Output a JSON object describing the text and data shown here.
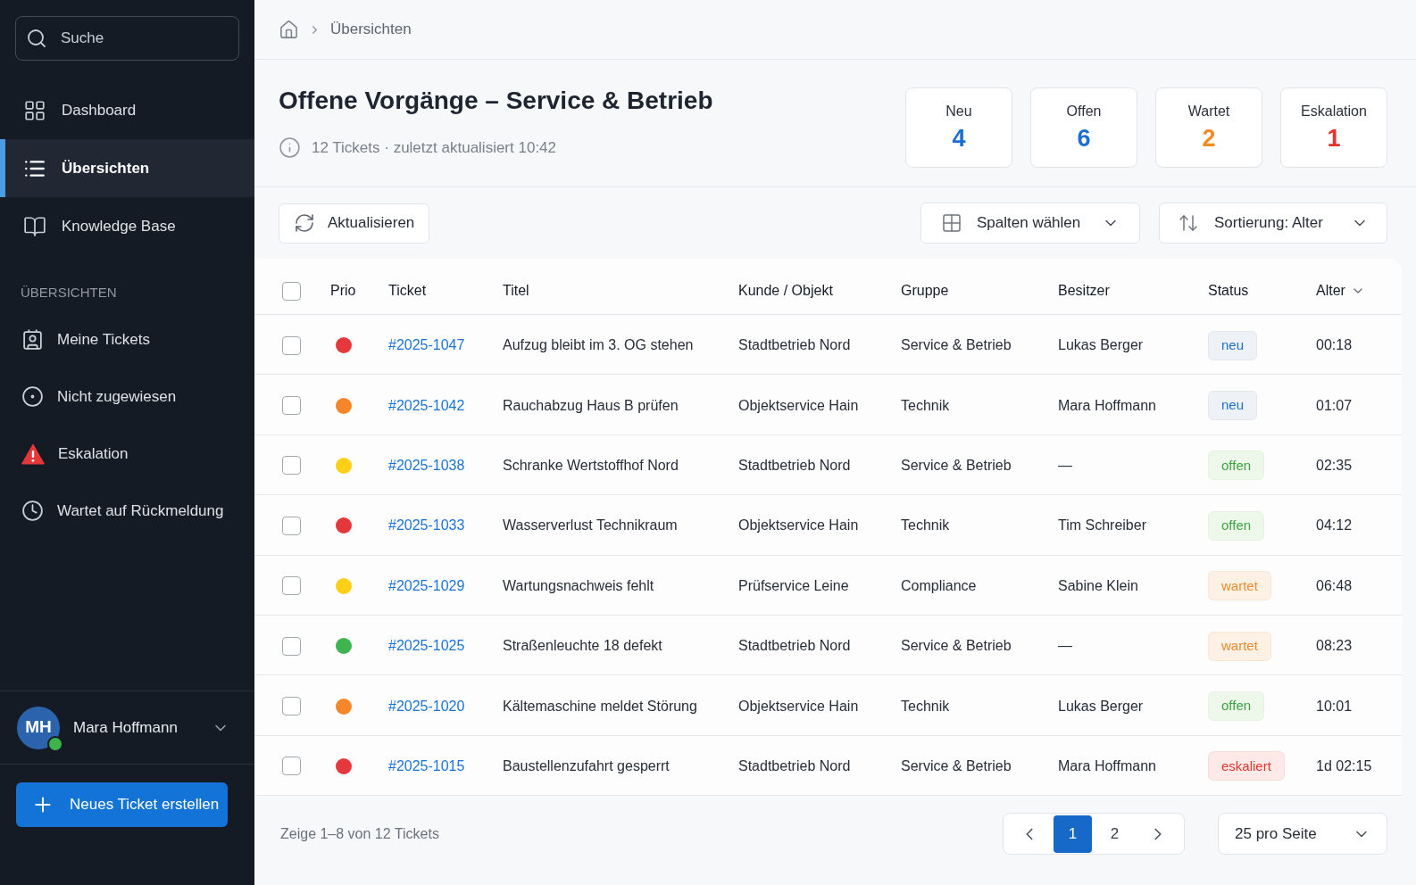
{
  "sidebar": {
    "search": {
      "placeholder": "Suche"
    },
    "nav": [
      {
        "label": "Dashboard",
        "selected": false
      },
      {
        "label": "Übersichten",
        "selected": true
      },
      {
        "label": "Knowledge Base",
        "selected": false
      }
    ],
    "section_heading": "ÜBERSICHTEN",
    "views": [
      {
        "label": "Meine Tickets",
        "selected": false
      },
      {
        "label": "Nicht zugewiesen",
        "selected": false
      },
      {
        "label": "Eskalation",
        "selected": false
      },
      {
        "label": "Wartet auf Rückmeldung",
        "selected": false
      }
    ],
    "user": {
      "initials": "MH",
      "name": "Mara Hoffmann",
      "online": true
    },
    "new_ticket_button": "Neues Ticket erstellen"
  },
  "breadcrumb": [
    "Übersichten"
  ],
  "header": {
    "title": "Offene Vorgänge – Service & Betrieb",
    "subtitle": "12 Tickets · zuletzt aktualisiert 10:42"
  },
  "stats": [
    {
      "label": "Neu",
      "value": "4",
      "color": "#1a6fd0"
    },
    {
      "label": "Offen",
      "value": "6",
      "color": "#1a6fd0"
    },
    {
      "label": "Wartet",
      "value": "2",
      "color": "#f28a26"
    },
    {
      "label": "Eskalation",
      "value": "1",
      "color": "#e0342d"
    }
  ],
  "toolbar": {
    "refresh_button": "Aktualisieren",
    "columns_select": "Spalten wählen",
    "sort_select": "Sortierung: Alter"
  },
  "table": {
    "select_all": {
      "checked": false
    },
    "columns": [
      {
        "label": "Prio",
        "sorted": false
      },
      {
        "label": "Ticket",
        "sorted": false
      },
      {
        "label": "Titel",
        "sorted": false
      },
      {
        "label": "Kunde / Objekt",
        "sorted": false
      },
      {
        "label": "Gruppe",
        "sorted": false
      },
      {
        "label": "Besitzer",
        "sorted": false
      },
      {
        "label": "Status",
        "sorted": false
      },
      {
        "label": "Alter",
        "sorted": true
      }
    ],
    "rows": [
      {
        "checked": false,
        "color": "#e5383b",
        "ticket": "#2025-1047",
        "title": "Aufzug bleibt im 3. OG stehen",
        "customer": "Stadtbetrieb Nord",
        "group": "Service & Betrieb",
        "owner": "Lukas Berger",
        "status": {
          "label": "neu",
          "kind": "new"
        },
        "age": "00:18"
      },
      {
        "checked": false,
        "color": "#f5862a",
        "ticket": "#2025-1042",
        "title": "Rauchabzug Haus B prüfen",
        "customer": "Objektservice Hain",
        "group": "Technik",
        "owner": "Mara Hoffmann",
        "status": {
          "label": "neu",
          "kind": "new"
        },
        "age": "01:07"
      },
      {
        "checked": false,
        "color": "#fdd017",
        "ticket": "#2025-1038",
        "title": "Schranke Wertstoffhof Nord",
        "customer": "Stadtbetrieb Nord",
        "group": "Service & Betrieb",
        "owner": "—",
        "status": {
          "label": "offen",
          "kind": "open"
        },
        "age": "02:35"
      },
      {
        "checked": false,
        "color": "#e5383b",
        "ticket": "#2025-1033",
        "title": "Wasserverlust Technikraum",
        "customer": "Objektservice Hain",
        "group": "Technik",
        "owner": "Tim Schreiber",
        "status": {
          "label": "offen",
          "kind": "open"
        },
        "age": "04:12"
      },
      {
        "checked": false,
        "color": "#fdd017",
        "ticket": "#2025-1029",
        "title": "Wartungsnachweis fehlt",
        "customer": "Prüfservice Leine",
        "group": "Compliance",
        "owner": "Sabine Klein",
        "status": {
          "label": "wartet",
          "kind": "waiting"
        },
        "age": "06:48"
      },
      {
        "checked": false,
        "color": "#3fb54f",
        "ticket": "#2025-1025",
        "title": "Straßenleuchte 18 defekt",
        "customer": "Stadtbetrieb Nord",
        "group": "Service & Betrieb",
        "owner": "—",
        "status": {
          "label": "wartet",
          "kind": "waiting"
        },
        "age": "08:23"
      },
      {
        "checked": false,
        "color": "#f5862a",
        "ticket": "#2025-1020",
        "title": "Kältemaschine meldet Störung",
        "customer": "Objektservice Hain",
        "group": "Technik",
        "owner": "Lukas Berger",
        "status": {
          "label": "offen",
          "kind": "open"
        },
        "age": "10:01"
      },
      {
        "checked": false,
        "color": "#e5383b",
        "ticket": "#2025-1015",
        "title": "Baustellenzufahrt gesperrt",
        "customer": "Stadtbetrieb Nord",
        "group": "Service & Betrieb",
        "owner": "Mara Hoffmann",
        "status": {
          "label": "eskaliert",
          "kind": "escalated"
        },
        "age": "1d 02:15"
      }
    ]
  },
  "footer": {
    "summary": "Zeige 1–8 von 12 Tickets",
    "pages": [
      {
        "label": "1",
        "selected": true
      },
      {
        "label": "2",
        "selected": false
      }
    ],
    "per_page": "25 pro Seite"
  }
}
